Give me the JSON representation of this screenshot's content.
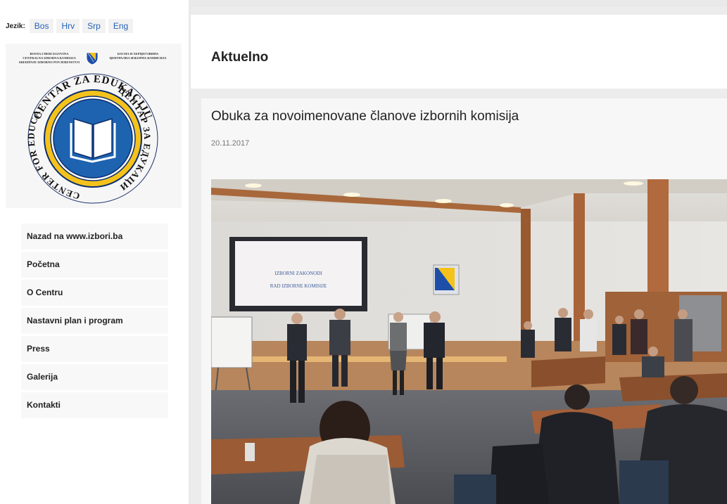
{
  "language": {
    "label": "Jezik:",
    "options": [
      "Bos",
      "Hrv",
      "Srp",
      "Eng"
    ]
  },
  "logo": {
    "left_lines": [
      "BOSNA I HERCEGOVINA",
      "CENTRALNA IZBORNA KOMISIJA",
      "SREDIŠNJE IZBORNO POVJERENSTVO"
    ],
    "right_lines": [
      "БОСНА И ХЕРЦЕГОВИНА",
      "ЦЕНТРАЛНА ИЗБОРНА КОМИСИЈА"
    ],
    "seal_top": "CENTAR ZA EDUKACIJU",
    "seal_right": "ЦЕНТАР ЗА ЕДУКАЦИЈУ",
    "seal_left": "CENTER FOR EDUCATION",
    "colors": {
      "ring": "#f4c21b",
      "inner": "#1d63b0",
      "navy": "#0d2d6b"
    }
  },
  "nav": {
    "items": [
      "Nazad na www.izbori.ba",
      "Početna",
      "O Centru",
      "Nastavni plan i program",
      "Press",
      "Galerija",
      "Kontakti"
    ]
  },
  "main": {
    "title": "Aktuelno",
    "article": {
      "title": "Obuka za novoimenovane članove izbornih komisija",
      "date": "20.11.2017",
      "photo": {
        "screen_lines": [
          "IZBORNI ZAKONODI",
          "RAD IZBORNE KOMISIJE"
        ]
      }
    }
  }
}
